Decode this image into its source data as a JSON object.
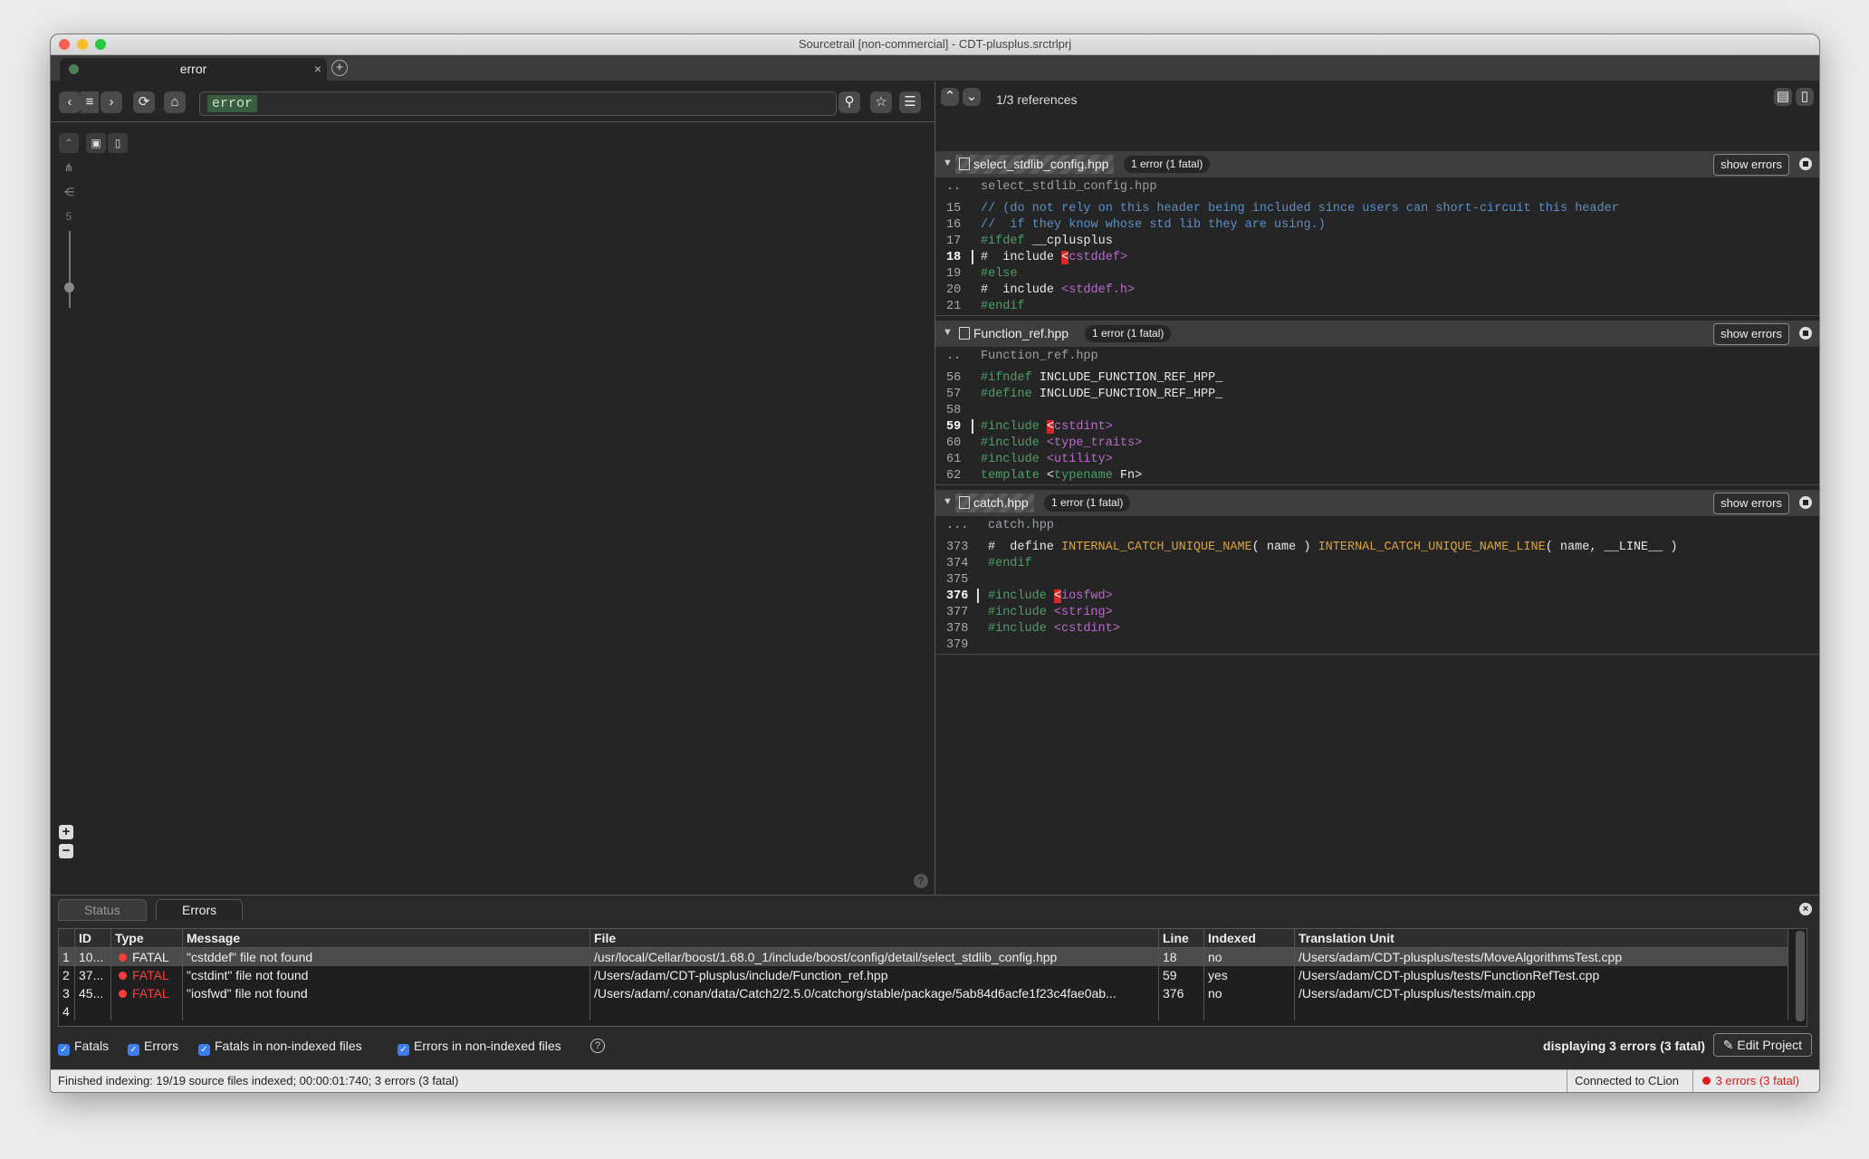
{
  "window": {
    "title": "Sourcetrail [non-commercial] - CDT-plusplus.srctrlprj"
  },
  "tab": {
    "label": "error",
    "close": "×",
    "new": "+"
  },
  "search": {
    "query": "error"
  },
  "nav": {
    "back": "‹",
    "history": "≡",
    "forward": "›",
    "refresh": "⟳",
    "home": "⌂",
    "search": "⚲",
    "bookmark": "☆",
    "bookmarks_menu": "☰"
  },
  "graph": {
    "depth_value": "5",
    "zoom_in": "+",
    "zoom_out": "−",
    "help": "?"
  },
  "code": {
    "reference_count": "1/3 references",
    "snippets": [
      {
        "file": "select_stdlib_config.hpp",
        "badge": "1 error (1 fatal)",
        "show_errors": "show errors",
        "title_prefix": "..",
        "title_line": "select_stdlib_config.hpp",
        "lines": [
          {
            "n": "15",
            "t": "// (do not rely on this header being included since users can short-circuit this header"
          },
          {
            "n": "16",
            "t": "//  if they know whose std lib they are using.)"
          },
          {
            "n": "17",
            "t": "#ifdef __cplusplus"
          },
          {
            "n": "18",
            "t": "#  include <cstddef>"
          },
          {
            "n": "19",
            "t": "#else"
          },
          {
            "n": "20",
            "t": "#  include <stddef.h>"
          },
          {
            "n": "21",
            "t": "#endif"
          }
        ]
      },
      {
        "file": "Function_ref.hpp",
        "badge": "1 error (1 fatal)",
        "show_errors": "show errors",
        "title_prefix": "..",
        "title_line": "Function_ref.hpp",
        "lines": [
          {
            "n": "56",
            "t": "#ifndef INCLUDE_FUNCTION_REF_HPP_"
          },
          {
            "n": "57",
            "t": "#define INCLUDE_FUNCTION_REF_HPP_"
          },
          {
            "n": "58",
            "t": ""
          },
          {
            "n": "59",
            "t": "#include <cstdint>"
          },
          {
            "n": "60",
            "t": "#include <type_traits>"
          },
          {
            "n": "61",
            "t": "#include <utility>"
          },
          {
            "n": "62",
            "t": "template <typename Fn>"
          }
        ]
      },
      {
        "file": "catch.hpp",
        "badge": "1 error (1 fatal)",
        "show_errors": "show errors",
        "title_prefix": "...",
        "title_line": "catch.hpp",
        "lines": [
          {
            "n": "373",
            "t": "#  define INTERNAL_CATCH_UNIQUE_NAME( name ) INTERNAL_CATCH_UNIQUE_NAME_LINE( name, __LINE__ )"
          },
          {
            "n": "374",
            "t": "#endif"
          },
          {
            "n": "375",
            "t": ""
          },
          {
            "n": "376",
            "t": "#include <iosfwd>"
          },
          {
            "n": "377",
            "t": "#include <string>"
          },
          {
            "n": "378",
            "t": "#include <cstdint>"
          },
          {
            "n": "379",
            "t": ""
          }
        ]
      }
    ]
  },
  "errors_panel": {
    "tabs": [
      "Status",
      "Errors"
    ],
    "close": "×",
    "columns": [
      "ID",
      "Type",
      "Message",
      "File",
      "Line",
      "Indexed",
      "Translation Unit"
    ],
    "rows": [
      {
        "idx": "1",
        "id": "10...",
        "type": "FATAL",
        "message": "\"cstddef\" file not found",
        "file": "/usr/local/Cellar/boost/1.68.0_1/include/boost/config/detail/select_stdlib_config.hpp",
        "line": "18",
        "indexed": "no",
        "tu": "/Users/adam/CDT-plusplus/tests/MoveAlgorithmsTest.cpp"
      },
      {
        "idx": "2",
        "id": "37...",
        "type": "FATAL",
        "message": "\"cstdint\" file not found",
        "file": "/Users/adam/CDT-plusplus/include/Function_ref.hpp",
        "line": "59",
        "indexed": "yes",
        "tu": "/Users/adam/CDT-plusplus/tests/FunctionRefTest.cpp"
      },
      {
        "idx": "3",
        "id": "45...",
        "type": "FATAL",
        "message": "\"iosfwd\" file not found",
        "file": "/Users/adam/.conan/data/Catch2/2.5.0/catchorg/stable/package/5ab84d6acfe1f23c4fae0ab...",
        "line": "376",
        "indexed": "no",
        "tu": "/Users/adam/CDT-plusplus/tests/main.cpp"
      },
      {
        "idx": "4",
        "id": "",
        "type": "",
        "message": "",
        "file": "",
        "line": "",
        "indexed": "",
        "tu": ""
      }
    ],
    "filters": [
      "Fatals",
      "Errors",
      "Fatals in non-indexed files",
      "Errors in non-indexed files"
    ],
    "help": "?",
    "displaying": "displaying 3 errors (3 fatal)",
    "edit_project": "Edit Project"
  },
  "status": {
    "message": "Finished indexing: 19/19 source files indexed; 00:00:01:740; 3 errors (3 fatal)",
    "connection": "Connected to CLion",
    "errors": "3 errors (3 fatal)"
  }
}
